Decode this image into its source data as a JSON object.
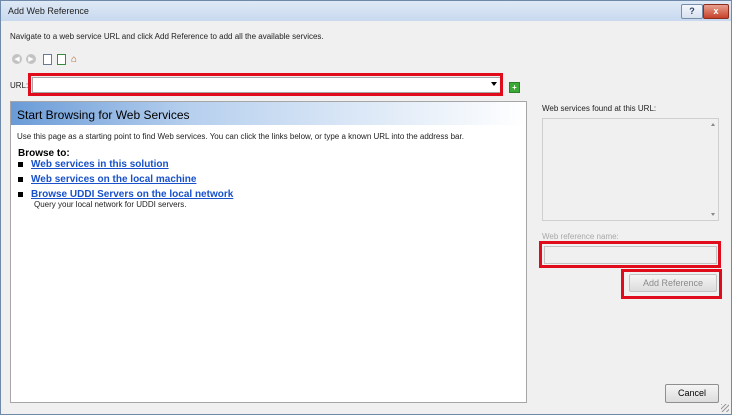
{
  "window": {
    "title": "Add Web Reference",
    "help_symbol": "?",
    "close_symbol": "x"
  },
  "instructions": "Navigate to a web service URL and click Add Reference to add all the available services.",
  "toolbar": {
    "icons": [
      "back-icon",
      "forward-icon",
      "stop-icon",
      "refresh-icon",
      "home-icon"
    ]
  },
  "url": {
    "label": "URL:",
    "value": ""
  },
  "go_symbol": "+",
  "browser": {
    "heading": "Start Browsing for Web Services",
    "intro": "Use this page as a starting point to find Web services. You can click the links below, or type a known URL into the address bar.",
    "browse_to": "Browse to:",
    "links": [
      "Web services in this solution",
      "Web services on the local machine",
      "Browse UDDI Servers on the local network"
    ],
    "uddi_description": "Query your local network for UDDI servers."
  },
  "services_panel": {
    "label": "Web services found at this URL:"
  },
  "reference_name": {
    "label": "Web reference name:",
    "value": ""
  },
  "buttons": {
    "add_reference": "Add Reference",
    "cancel": "Cancel"
  },
  "colors": {
    "highlight": "#e00c1c",
    "link": "#1851c9"
  }
}
